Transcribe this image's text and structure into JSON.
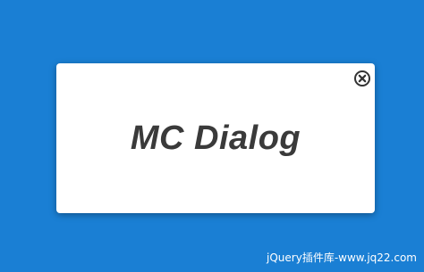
{
  "page": {
    "background_color": "#1a7fd4"
  },
  "dialog": {
    "title": "MC Dialog",
    "close_icon": "close-circle-icon",
    "background_color": "#ffffff",
    "title_color": "#3a3a3a"
  },
  "watermark": {
    "text": "jQuery插件库-www.jq22.com"
  }
}
